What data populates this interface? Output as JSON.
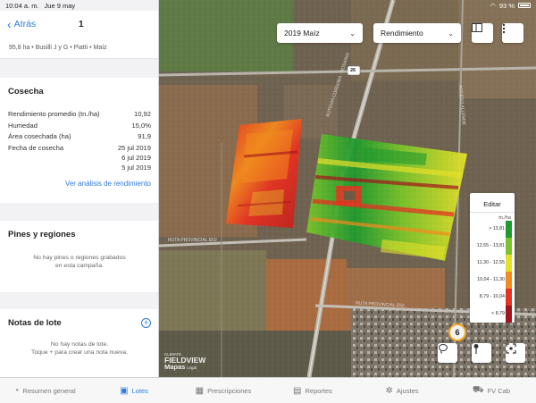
{
  "status": {
    "time": "10:04 a. m.",
    "date": "Jue 9 may",
    "battery": "93 %"
  },
  "nav": {
    "back_label": "Atrás",
    "title": "1"
  },
  "summary": "95,8 ha • Busilli J y G • Piatti • Maíz",
  "harvest": {
    "heading": "Cosecha",
    "rows": [
      {
        "label": "Rendimiento promedio (tn./ha)",
        "value": "10,92"
      },
      {
        "label": "Humedad",
        "value": "15,0%"
      },
      {
        "label": "Área cosechada (ha)",
        "value": "91,9"
      },
      {
        "label": "Fecha de cosecha",
        "value": "25 jul 2019"
      }
    ],
    "extra_dates": [
      "6 jul 2019",
      "5 jul 2019"
    ],
    "link": "Ver análisis de rendimiento"
  },
  "pins": {
    "heading": "Pines y regiones",
    "empty_line1": "No hay pines o regiones grabados",
    "empty_line2": "en esta campaña."
  },
  "notes": {
    "heading": "Notas de lote",
    "empty_line1": "No hay notas de lote.",
    "empty_line2": "Toque + para crear una nota nueva."
  },
  "map": {
    "season_select": "2019 Maíz",
    "layer_select": "Rendimiento",
    "route_shield": "26",
    "road_labels": [
      "AUTOVIA CORDOBA - ROSARIO",
      "ACCESO ALLENDE",
      "RUTA PROVINCIAL E52",
      "RUTA PROVINCIAL E52"
    ],
    "badge_count": "6",
    "watermark_brand": "FIELDVIEW",
    "watermark_maps": "Mapas",
    "watermark_top": "CLIMATE",
    "watermark_legal": "Legal"
  },
  "legend": {
    "edit_label": "Editar",
    "unit": "tn./ha",
    "items": [
      {
        "label": "> 13,81",
        "color": "#1e9a2e"
      },
      {
        "label": "12,55 - 13,81",
        "color": "#7cc42a"
      },
      {
        "label": "11,30 - 12,55",
        "color": "#e5e02a"
      },
      {
        "label": "10,04 - 11,30",
        "color": "#f28a1d"
      },
      {
        "label": "8,79 - 10,04",
        "color": "#e53222"
      },
      {
        "label": "< 8,79",
        "color": "#a3141c"
      }
    ]
  },
  "tabs": [
    {
      "label": "Resumen general",
      "icon": "gauge-icon",
      "active": false
    },
    {
      "label": "Lotes",
      "icon": "field-icon",
      "active": true
    },
    {
      "label": "Prescripciones",
      "icon": "grid-icon",
      "active": false
    },
    {
      "label": "Reportes",
      "icon": "document-icon",
      "active": false
    },
    {
      "label": "Ajustes",
      "icon": "gear-icon",
      "active": false
    },
    {
      "label": "FV Cab",
      "icon": "tractor-icon",
      "active": false
    }
  ]
}
